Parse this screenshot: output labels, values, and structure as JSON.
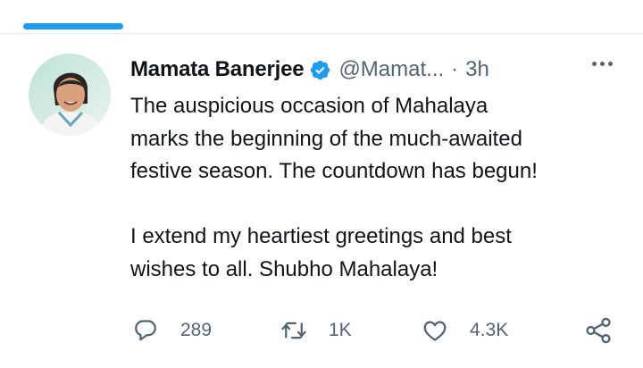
{
  "tweet": {
    "author_name": "Mamata Banerjee",
    "author_handle": "@Mamat...",
    "separator": "·",
    "timestamp": "3h",
    "lines": [
      "The auspicious occasion of Mahalaya",
      "marks the beginning of the much-awaited",
      "festive season. The countdown has begun!",
      "",
      "I extend my heartiest greetings and best",
      "wishes to all. Shubho Mahalaya!"
    ],
    "metrics": {
      "replies": "289",
      "retweets": "1K",
      "likes": "4.3K"
    }
  },
  "icons": {
    "verified": "verified-badge-icon",
    "more": "more-dots-icon",
    "reply": "reply-bubble-icon",
    "retweet": "retweet-icon",
    "like": "heart-icon",
    "share": "share-icon"
  },
  "colors": {
    "accent": "#1d9bf0",
    "text": "#0f1419",
    "muted": "#536471"
  }
}
